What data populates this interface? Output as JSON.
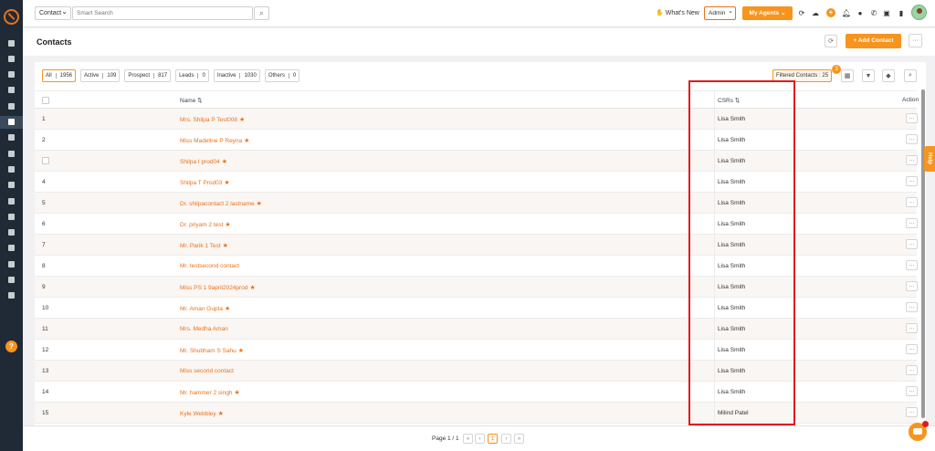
{
  "sidebar": {
    "items": [
      "dashboard-icon",
      "user-icon",
      "copy-icon",
      "bank-icon",
      "list-icon",
      "contacts-icon",
      "filter-icon",
      "megaphone-icon",
      "document-icon",
      "chart-icon",
      "folder-icon",
      "google-icon",
      "calculator-icon",
      "mail-icon",
      "plane-icon",
      "analytics-icon",
      "gear-icon"
    ],
    "help_label": "?"
  },
  "topbar": {
    "module": "Contact",
    "search_placeholder": "Smart Search",
    "whats_new": "What's New",
    "role": "Admin",
    "agents_label": "My Agents"
  },
  "header": {
    "title": "Contacts",
    "add_label": "Add Contact",
    "more_label": "···"
  },
  "filters": [
    {
      "label": "All",
      "count": "1956"
    },
    {
      "label": "Active",
      "count": "109"
    },
    {
      "label": "Prospect",
      "count": "817"
    },
    {
      "label": "Leads",
      "count": "0"
    },
    {
      "label": "Inactive",
      "count": "1030"
    },
    {
      "label": "Others",
      "count": "0"
    }
  ],
  "filtered": {
    "label": "Filtered Contacts : 25",
    "badge": "3"
  },
  "columns": {
    "name": "Name",
    "csrs": "CSRs",
    "action": "Action"
  },
  "rows": [
    {
      "num": "1",
      "name": "Mrs. Shilpa P Test008",
      "star": true,
      "csr": "Lisa Smith"
    },
    {
      "num": "2",
      "name": "Miss Madeline P Reyna",
      "star": true,
      "csr": "Lisa Smith"
    },
    {
      "num": "",
      "name": "Shilpa I prod04",
      "star": true,
      "csr": "Lisa Smith"
    },
    {
      "num": "4",
      "name": "Shilpa T Prod03",
      "star": true,
      "csr": "Lisa Smith"
    },
    {
      "num": "5",
      "name": "Dr. shilpacontact 2 lastname",
      "star": true,
      "csr": "Lisa Smith"
    },
    {
      "num": "6",
      "name": "Dr. priyam 2 test",
      "star": true,
      "csr": "Lisa Smith"
    },
    {
      "num": "7",
      "name": "Mr. Parik 1 Test",
      "star": true,
      "csr": "Lisa Smith"
    },
    {
      "num": "8",
      "name": "Mr. testsecond contact",
      "star": false,
      "csr": "Lisa Smith"
    },
    {
      "num": "9",
      "name": "Miss PS 1 9april2024prod",
      "star": true,
      "csr": "Lisa Smith"
    },
    {
      "num": "10",
      "name": "Mr. Aman Gupta",
      "star": true,
      "csr": "Lisa Smith"
    },
    {
      "num": "11",
      "name": "Mrs. Medha Aman",
      "star": false,
      "csr": "Lisa Smith"
    },
    {
      "num": "12",
      "name": "Mr. Shubham S Sahu",
      "star": true,
      "csr": "Lisa Smith"
    },
    {
      "num": "13",
      "name": "Miss second contact",
      "star": false,
      "csr": "Lisa Smith"
    },
    {
      "num": "14",
      "name": "Mr. hammer 2 singh",
      "star": true,
      "csr": "Lisa Smith"
    },
    {
      "num": "15",
      "name": "Kyle Webbley",
      "star": true,
      "csr": "Milind Patel"
    }
  ],
  "pagination": {
    "info": "Page 1 / 1",
    "current": "1"
  },
  "help_tab": "Help",
  "colors": {
    "accent": "#f7941d",
    "highlight": "#e01b1b",
    "sidebar": "#1f2a36"
  }
}
